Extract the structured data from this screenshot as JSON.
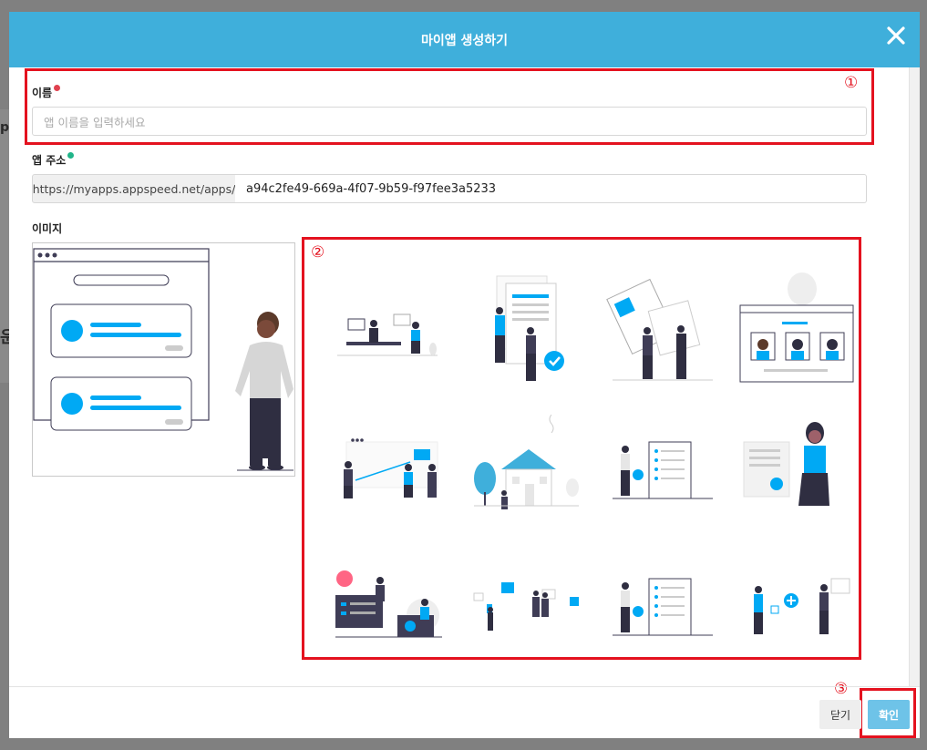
{
  "background": {
    "partial_texts": [
      "p",
      "운"
    ]
  },
  "modal": {
    "title": "마이앱 생성하기",
    "close_icon": "close-icon"
  },
  "form": {
    "name_label": "이름",
    "name_placeholder": "앱 이름을 입력하세요",
    "address_label": "앱 주소",
    "address_prefix": "https://myapps.appspeed.net/apps/",
    "address_value": "a94c2fe49-669a-4f07-9b59-f97fee3a5233",
    "image_label": "이미지"
  },
  "annotations": {
    "one": "①",
    "two": "②",
    "three": "③"
  },
  "image_options": [
    {
      "name": "team-meeting"
    },
    {
      "name": "documents-approval"
    },
    {
      "name": "handshake-contract"
    },
    {
      "name": "video-call"
    },
    {
      "name": "presentation"
    },
    {
      "name": "house"
    },
    {
      "name": "checklist"
    },
    {
      "name": "woman-document"
    },
    {
      "name": "dashboard"
    },
    {
      "name": "floating-cards"
    },
    {
      "name": "checklist-2"
    },
    {
      "name": "add-content"
    }
  ],
  "footer": {
    "close_label": "닫기",
    "ok_label": "확인"
  },
  "colors": {
    "header": "#3fafdb",
    "accent": "#00a9f4",
    "red": "#e4121f",
    "required_dot": "#e0414f",
    "info_dot": "#21b589"
  }
}
